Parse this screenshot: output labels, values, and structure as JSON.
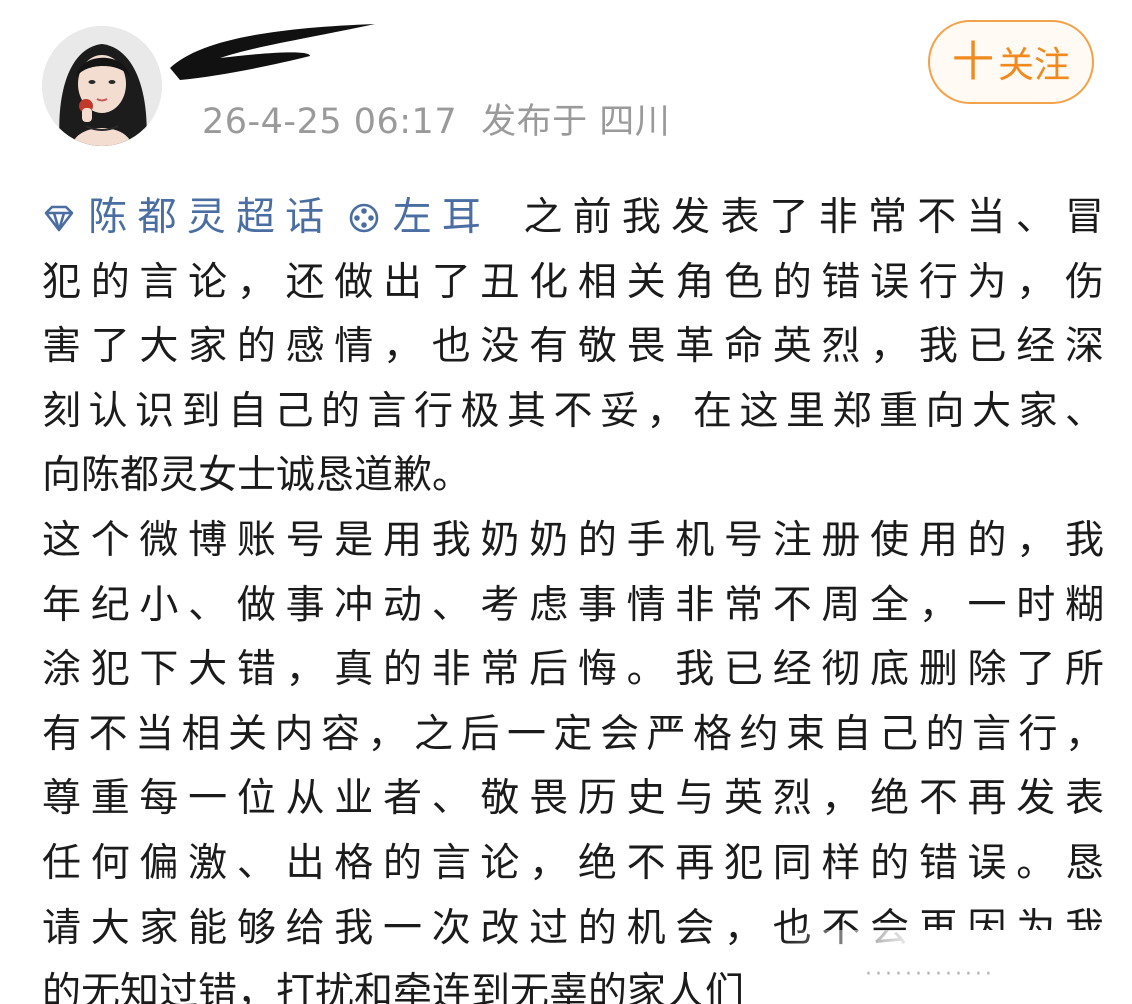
{
  "post": {
    "date": "26-4-25 06:17",
    "location": "发布于 四川",
    "follow_label": "关注",
    "follow_plus": "十",
    "topic_label": "陈都灵超话",
    "mention_label": "左耳",
    "first_line_text": "之前我发表了非常不当、冒",
    "lines": [
      "犯的言论，还做出了丑化相关角色的错误行为，伤",
      "害了大家的感情，也没有敬畏革命英烈，我已经深",
      "刻认识到自己的言行极其不妥，在这里郑重向大家、",
      "向陈都灵女士诚恳道歉。",
      "这个微博账号是用我奶奶的手机号注册使用的，我",
      "年纪小、做事冲动、考虑事情非常不周全，一时糊",
      "涂犯下大错，真的非常后悔。我已经彻底删除了所",
      "有不当相关内容，之后一定会严格约束自己的言行，",
      "尊重每一位从业者、敬畏历史与英烈，绝不再发表",
      "任何偏激、出格的言论，绝不再犯同样的错误。恳",
      "请大家能够给我一次改过的机会，也不会再因为我",
      "的无知过错，打扰和牵连到无辜的家人们"
    ],
    "truncation_dots": "·············"
  },
  "colors": {
    "topic_blue": "#4a6ea2",
    "follow_orange": "#f08a1e",
    "meta_gray": "#9a9a9a"
  },
  "icons": {
    "topic": "diamond-icon",
    "mention": "film-reel-icon",
    "follow": "plus-icon"
  }
}
